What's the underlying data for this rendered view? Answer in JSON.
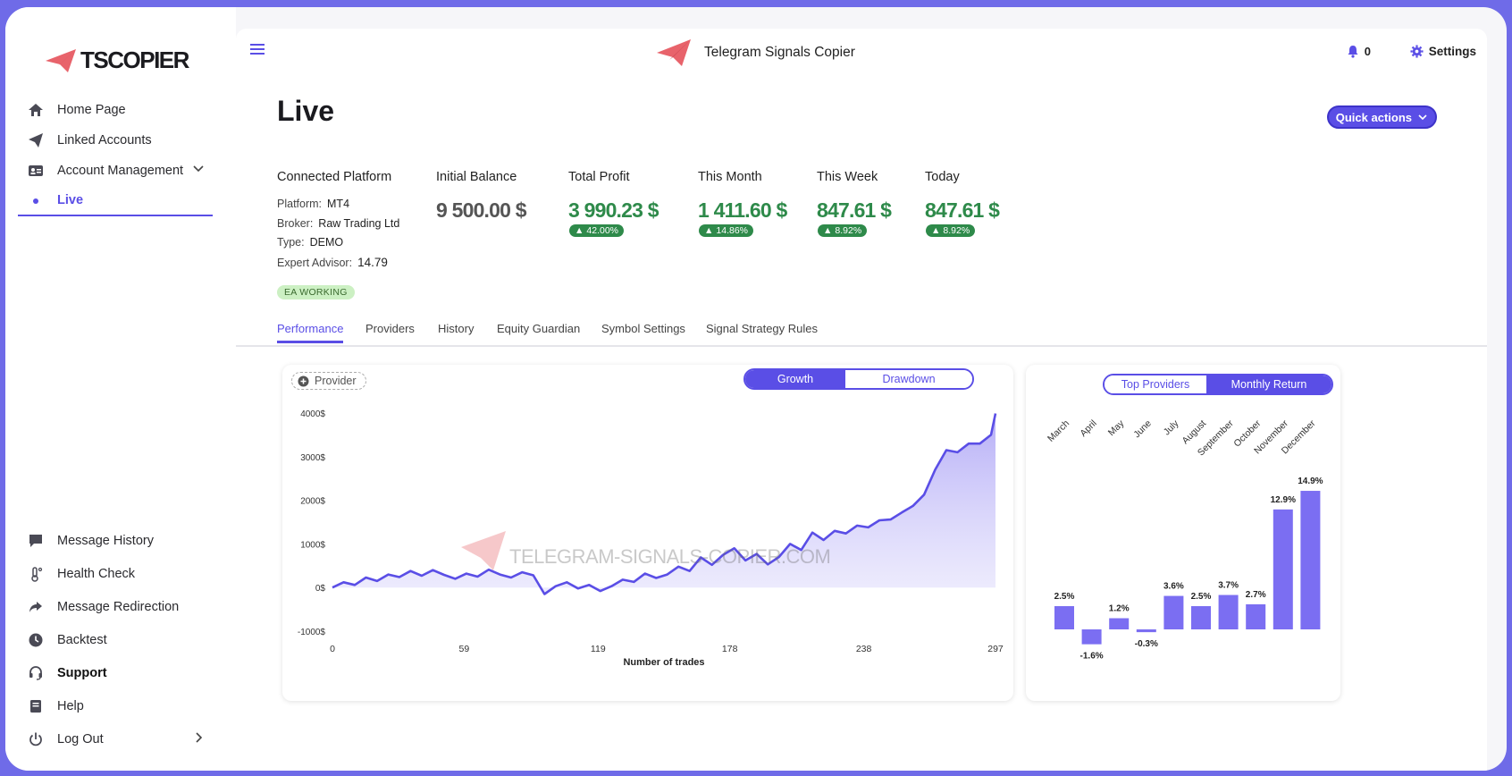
{
  "brand": {
    "logo_text": "TSCOPIER",
    "app_title": "Telegram Signals Copier"
  },
  "sidebar": {
    "items": [
      {
        "label": "Home Page",
        "icon": "home-icon"
      },
      {
        "label": "Linked Accounts",
        "icon": "paper-plane-icon"
      },
      {
        "label": "Account Management",
        "icon": "id-card-icon"
      },
      {
        "label": "Live",
        "icon": "dot-icon"
      }
    ],
    "bottom_items": [
      {
        "label": "Message History",
        "icon": "chat-icon"
      },
      {
        "label": "Health Check",
        "icon": "thermometer-icon"
      },
      {
        "label": "Message Redirection",
        "icon": "share-icon"
      },
      {
        "label": "Backtest",
        "icon": "clock-icon"
      },
      {
        "label": "Support",
        "icon": "headset-icon"
      },
      {
        "label": "Help",
        "icon": "book-icon"
      },
      {
        "label": "Log Out",
        "icon": "power-icon"
      }
    ]
  },
  "header": {
    "notifications_count": "0",
    "settings_label": "Settings"
  },
  "page": {
    "title": "Live",
    "quick_actions_label": "Quick actions",
    "connected_platform": {
      "label": "Connected Platform",
      "platform_label": "Platform:",
      "platform": "MT4",
      "broker_label": "Broker:",
      "broker": "Raw Trading Ltd",
      "type_label": "Type:",
      "type": "DEMO",
      "ea_label": "Expert Advisor:",
      "ea": "14.79",
      "status": "EA WORKING"
    },
    "stats": {
      "initial_balance": {
        "label": "Initial Balance",
        "value": "9 500.00 $"
      },
      "total_profit": {
        "label": "Total Profit",
        "value": "3 990.23 $",
        "pct": "42.00%"
      },
      "this_month": {
        "label": "This Month",
        "value": "1 411.60 $",
        "pct": "14.86%"
      },
      "this_week": {
        "label": "This Week",
        "value": "847.61 $",
        "pct": "8.92%"
      },
      "today": {
        "label": "Today",
        "value": "847.61 $",
        "pct": "8.92%"
      }
    },
    "tabs": [
      "Performance",
      "Providers",
      "History",
      "Equity Guardian",
      "Symbol Settings",
      "Signal Strategy Rules"
    ]
  },
  "growth_card": {
    "provider_label": "Provider",
    "toggle": [
      "Growth",
      "Drawdown"
    ],
    "watermark": "TELEGRAM-SIGNALS-COPIER.COM"
  },
  "monthly_card": {
    "toggle": [
      "Top Providers",
      "Monthly Return"
    ]
  },
  "colors": {
    "accent": "#5a4ee6",
    "green": "#2e8a4a",
    "frame": "#6f6be8",
    "logo_red": "#e8636b"
  },
  "chart_data": [
    {
      "type": "area",
      "xlabel": "Number of trades",
      "ylabel": "",
      "x_ticks": [
        0,
        59,
        119,
        178,
        238,
        297
      ],
      "y_ticks": [
        "4000$",
        "3000$",
        "2000$",
        "1000$",
        "0$",
        "-1000$"
      ],
      "ylim": [
        -1000,
        4000
      ],
      "xlim": [
        0,
        297
      ],
      "x": [
        0,
        5,
        10,
        15,
        20,
        25,
        30,
        35,
        40,
        45,
        50,
        55,
        60,
        65,
        70,
        75,
        80,
        85,
        90,
        95,
        100,
        105,
        110,
        115,
        120,
        125,
        130,
        135,
        140,
        145,
        150,
        155,
        160,
        165,
        170,
        175,
        180,
        185,
        190,
        195,
        200,
        205,
        210,
        215,
        220,
        225,
        230,
        235,
        240,
        245,
        250,
        255,
        260,
        265,
        270,
        275,
        280,
        285,
        290,
        295,
        297
      ],
      "y": [
        0,
        120,
        60,
        230,
        150,
        300,
        240,
        380,
        270,
        400,
        290,
        200,
        320,
        250,
        410,
        300,
        230,
        350,
        280,
        -150,
        30,
        120,
        -20,
        60,
        -80,
        30,
        180,
        130,
        320,
        220,
        300,
        480,
        380,
        690,
        520,
        750,
        900,
        620,
        770,
        530,
        700,
        1000,
        860,
        1260,
        1090,
        1300,
        1240,
        1420,
        1380,
        1540,
        1560,
        1720,
        1870,
        2130,
        2700,
        3150,
        3100,
        3300,
        3300,
        3500,
        3990
      ]
    },
    {
      "type": "bar",
      "title": "",
      "categories": [
        "March",
        "April",
        "May",
        "June",
        "July",
        "August",
        "September",
        "October",
        "November",
        "December"
      ],
      "values": [
        2.5,
        -1.6,
        1.2,
        -0.3,
        3.6,
        2.5,
        3.7,
        2.7,
        12.9,
        14.9
      ],
      "labels": [
        "2.5%",
        "-1.6%",
        "1.2%",
        "-0.3%",
        "3.6%",
        "2.5%",
        "3.7%",
        "2.7%",
        "12.9%",
        "14.9%"
      ]
    }
  ]
}
